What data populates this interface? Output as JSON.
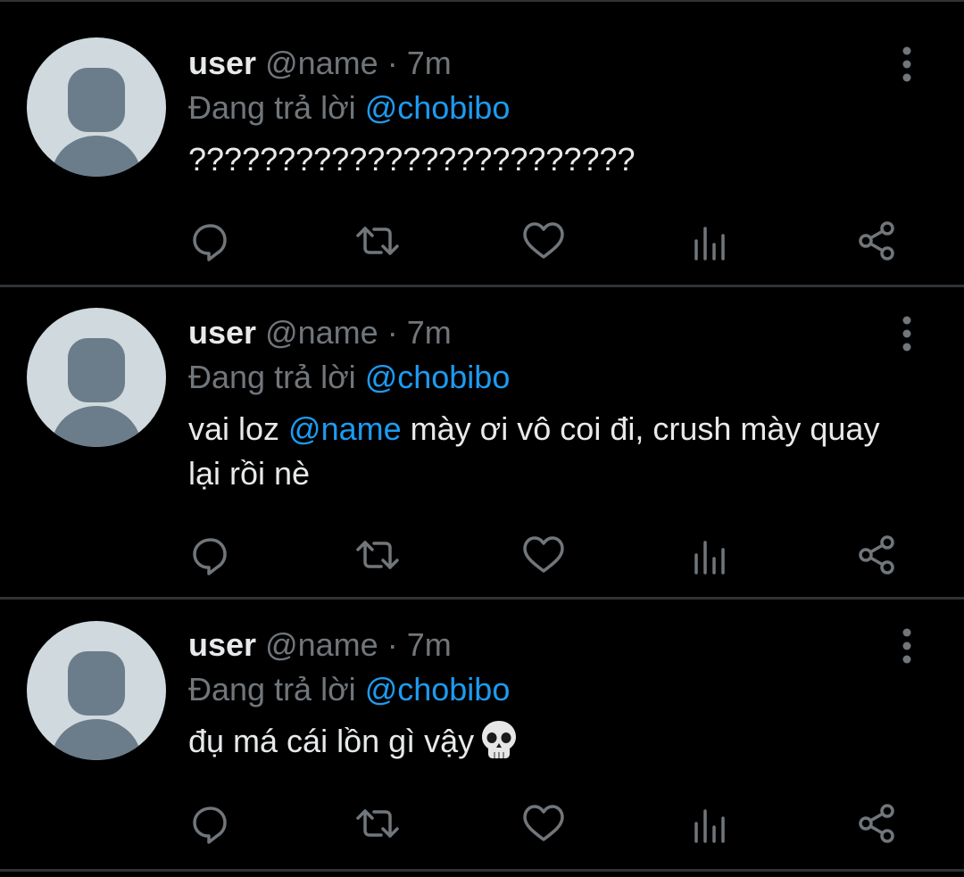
{
  "colors": {
    "background": "#000000",
    "text": "#e7e9ea",
    "muted": "#71767b",
    "accent": "#1d9bf0",
    "divider": "#2f3336",
    "avatar_bg": "#cfd9de",
    "avatar_fg": "#6b7c8a"
  },
  "tweets": [
    {
      "user_name": "user",
      "handle": "@name",
      "dot": "·",
      "time": "7m",
      "reply_prefix": "Đang trả lời ",
      "reply_to": "@chobibo",
      "text": "?????????????????????????",
      "icons": [
        "reply-icon",
        "retweet-icon",
        "like-icon",
        "analytics-icon",
        "share-icon",
        "more-vertical-icon"
      ]
    },
    {
      "user_name": "user",
      "handle": "@name",
      "dot": "·",
      "time": "7m",
      "reply_prefix": "Đang trả lời ",
      "reply_to": "@chobibo",
      "text_part1": "vai loz ",
      "text_mention": "@name",
      "text_part2": " mày ơi vô coi đi, crush mày quay lại rồi nè",
      "icons": [
        "reply-icon",
        "retweet-icon",
        "like-icon",
        "analytics-icon",
        "share-icon",
        "more-vertical-icon"
      ]
    },
    {
      "user_name": "user",
      "handle": "@name",
      "dot": "·",
      "time": "7m",
      "reply_prefix": "Đang trả lời ",
      "reply_to": "@chobibo",
      "text": "đụ má cái lồn gì vậy",
      "emoji": "skull-emoji",
      "icons": [
        "reply-icon",
        "retweet-icon",
        "like-icon",
        "analytics-icon",
        "share-icon",
        "more-vertical-icon"
      ]
    }
  ]
}
